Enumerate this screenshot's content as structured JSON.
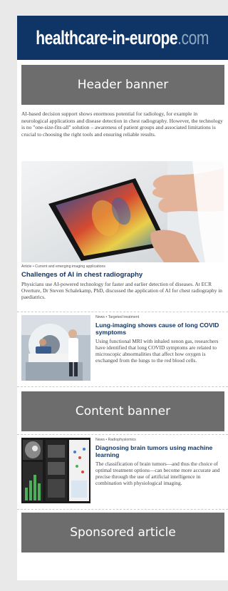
{
  "site": {
    "logo_main": "healthcare-in-europe",
    "logo_tld": ".com"
  },
  "banners": {
    "header": "Header banner",
    "content": "Content banner",
    "sponsored": "Sponsored article"
  },
  "intro_text": "AI-based decision support shows enormous potential for radiology, for example in neurological applications and disease detection in chest radiography. However, the technology is no \"one-size-fits-all\" solution – awareness of patient groups and associated limitations is crucial to choosing the right tools and ensuring reliable results.",
  "featured": {
    "kicker": "Article • Current and emerging imaging applications",
    "title": "Challenges of AI in chest radiography",
    "summary": "Physicians use AI-powered technology for faster and earlier detection of diseases. At ECR Overture, Dr Steven Schalekamp, PhD, discussed the application of AI for chest radiography in paediatrics."
  },
  "articles": [
    {
      "kicker": "News • Targeted treatment",
      "title": "Lung-imaging shows cause of long COVID symptoms",
      "summary": "Using functional MRI with inhaled xenon gas, researchers have identified that long COVID symptoms are related to microscopic abnormalities that affect how oxygen is exchanged from the lungs to the red blood cells."
    },
    {
      "kicker": "News • Radiophysiomics",
      "title": "Diagnosing brain tumors using machine learning",
      "summary": "The classification of brain tumors—and thus the choice of optimal treatment options—can become more accurate and precise through the use of artificial intelligence in combination with physiological imaging."
    }
  ],
  "colors": {
    "brand_navy": "#0f3566",
    "banner_gray": "#6d6d6d",
    "page_bg": "#e9e9e9"
  }
}
